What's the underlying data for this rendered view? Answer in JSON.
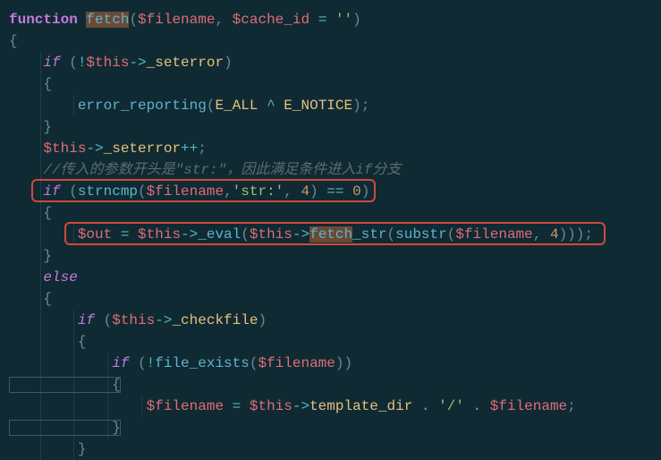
{
  "code": {
    "l1_kw": "function",
    "l1_fn": "fetch",
    "l1_p1": "(",
    "l1_var1": "$filename",
    "l1_c1": ", ",
    "l1_var2": "$cache_id",
    "l1_eq": " = ",
    "l1_str": "''",
    "l1_p2": ")",
    "l2": "{",
    "l3_kw": "if",
    "l3_p1": " (",
    "l3_op": "!",
    "l3_var": "$this",
    "l3_arr": "->",
    "l3_prop": "_seterror",
    "l3_p2": ")",
    "l4": "    {",
    "l5_fn": "error_reporting",
    "l5_p1": "(",
    "l5_c1": "E_ALL",
    "l5_op": " ^ ",
    "l5_c2": "E_NOTICE",
    "l5_p2": ");",
    "l6": "    }",
    "l7_var": "$this",
    "l7_arr": "->",
    "l7_prop": "_seterror",
    "l7_op": "++",
    "l7_p": ";",
    "l8_comment": "//传入的参数开头是\"str:\"，因此满足条件进入if分支",
    "l9_kw": "if",
    "l9_p1": " (",
    "l9_fn": "strncmp",
    "l9_p2": "(",
    "l9_var": "$filename",
    "l9_c1": ",",
    "l9_str": "'str:'",
    "l9_c2": ", ",
    "l9_num": "4",
    "l9_p3": ") ",
    "l9_op": "==",
    "l9_sp": " ",
    "l9_num2": "0",
    "l9_p4": ")",
    "l10": "    {",
    "l11_var1": "$out",
    "l11_eq": " = ",
    "l11_var2": "$this",
    "l11_arr1": "->",
    "l11_fn1": "_eval",
    "l11_p1": "(",
    "l11_var3": "$this",
    "l11_arr2": "->",
    "l11_fn2a": "fetch",
    "l11_fn2b": "_str",
    "l11_p2": "(",
    "l11_fn3": "substr",
    "l11_p3": "(",
    "l11_var4": "$filename",
    "l11_c1": ", ",
    "l11_num": "4",
    "l11_p4": ")));",
    "l12": "    }",
    "l13_kw": "else",
    "l14": "    {",
    "l15_kw": "if",
    "l15_p1": " (",
    "l15_var": "$this",
    "l15_arr": "->",
    "l15_prop": "_checkfile",
    "l15_p2": ")",
    "l16": "        {",
    "l17_kw": "if",
    "l17_p1": " (",
    "l17_op": "!",
    "l17_fn": "file_exists",
    "l17_p2": "(",
    "l17_var": "$filename",
    "l17_p3": "))",
    "l18": "            {",
    "l19_var1": "$filename",
    "l19_eq": " = ",
    "l19_var2": "$this",
    "l19_arr": "->",
    "l19_prop": "template_dir",
    "l19_op1": " . ",
    "l19_str": "'/'",
    "l19_op2": " . ",
    "l19_var3": "$filename",
    "l19_p": ";",
    "l20": "            }",
    "l21": "        }"
  }
}
